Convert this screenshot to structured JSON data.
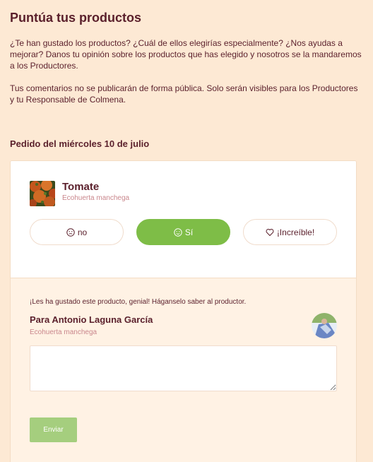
{
  "header": {
    "title": "Puntúa tus productos",
    "intro_p1": "¿Te han gustado los productos? ¿Cuál de ellos elegirías especialmente? ¿Nos ayudas a mejorar? Danos tu opinión sobre los productos que has elegido y nosotros se la mandaremos a los Productores.",
    "intro_p2": "Tus comentarios no se publicarán de forma pública. Solo serán visibles para los Productores y tu Responsable de Colmena."
  },
  "order": {
    "title": "Pedido del miércoles 10 de julio"
  },
  "product": {
    "name": "Tomate",
    "producer": "Ecohuerta manchega",
    "thumbnail_icon": "tomato-photo"
  },
  "rating": {
    "options": [
      {
        "label": "no",
        "icon": "neutral-face-icon",
        "active": false
      },
      {
        "label": "Sí",
        "icon": "smile-face-icon",
        "active": true
      },
      {
        "label": "¡Increíble!",
        "icon": "heart-icon",
        "active": false
      }
    ],
    "active_color": "#7ebd47"
  },
  "feedback": {
    "message": "¡Les ha gustado este producto, genial! Háganselo saber al productor.",
    "recipient": "Para Antonio Laguna García",
    "recipient_farm": "Ecohuerta manchega",
    "comment_value": "",
    "submit_label": "Enviar"
  },
  "colors": {
    "background": "#fde9d4",
    "text": "#5a1f2b",
    "muted": "#c9868c",
    "submit": "#a5ce7e"
  }
}
